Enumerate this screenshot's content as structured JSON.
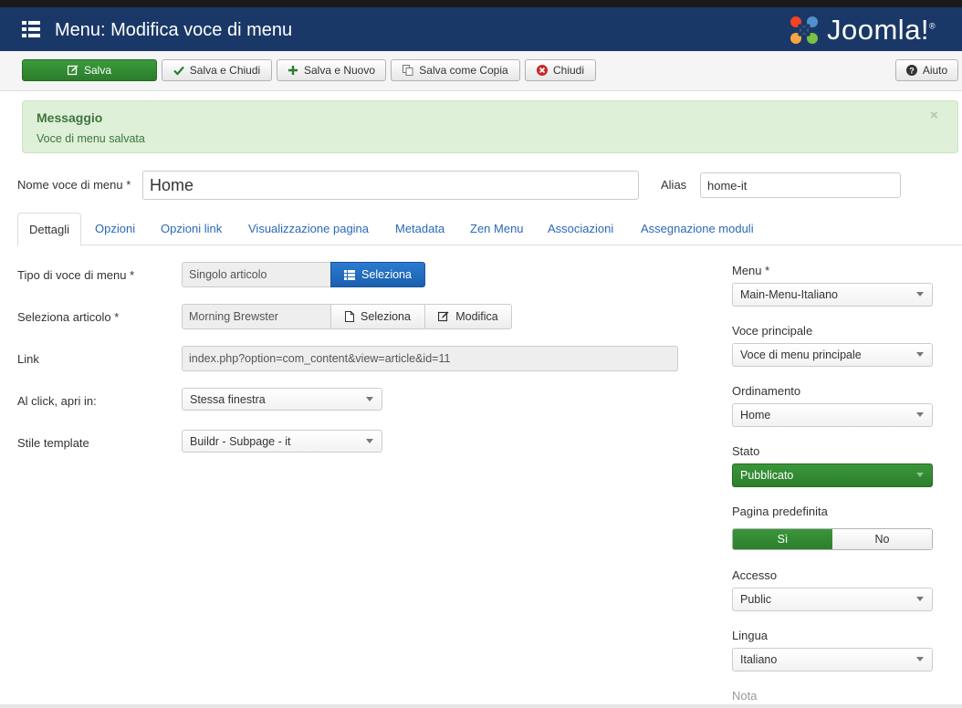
{
  "header": {
    "title": "Menu: Modifica voce di menu",
    "logo_text": "Joomla!",
    "logo_mark": "®"
  },
  "toolbar": {
    "save": "Salva",
    "save_close": "Salva e Chiudi",
    "save_new": "Salva e Nuovo",
    "save_copy": "Salva come Copia",
    "close": "Chiudi",
    "help": "Aiuto"
  },
  "alert": {
    "title": "Messaggio",
    "text": "Voce di menu salvata",
    "close": "×"
  },
  "form": {
    "title_label": "Nome voce di menu *",
    "title_value": "Home",
    "alias_label": "Alias",
    "alias_value": "home-it"
  },
  "tabs": [
    "Dettagli",
    "Opzioni",
    "Opzioni link",
    "Visualizzazione pagina",
    "Metadata",
    "Zen Menu",
    "Associazioni",
    "Assegnazione moduli"
  ],
  "details": {
    "type_label": "Tipo di voce di menu *",
    "type_value": "Singolo articolo",
    "type_button": "Seleziona",
    "article_label": "Seleziona articolo *",
    "article_value": "Morning Brewster",
    "article_select": "Seleziona",
    "article_edit": "Modifica",
    "link_label": "Link",
    "link_value": "index.php?option=com_content&view=article&id=11",
    "browser_label": "Al click, apri in:",
    "browser_value": "Stessa finestra",
    "template_label": "Stile template",
    "template_value": "Buildr - Subpage - it"
  },
  "sidebar": {
    "menu_label": "Menu *",
    "menu_value": "Main-Menu-Italiano",
    "parent_label": "Voce principale",
    "parent_value": "Voce di menu principale",
    "order_label": "Ordinamento",
    "order_value": "Home",
    "status_label": "Stato",
    "status_value": "Pubblicato",
    "default_label": "Pagina predefinita",
    "default_yes": "Sì",
    "default_no": "No",
    "access_label": "Accesso",
    "access_value": "Public",
    "language_label": "Lingua",
    "language_value": "Italiano",
    "note_label": "Nota"
  },
  "colors": {
    "header_bg": "#1a3867",
    "success_green": "#2b7d2b",
    "primary_blue": "#1b5fae",
    "link_blue": "#2a69b8",
    "alert_bg": "#dff0d8"
  }
}
